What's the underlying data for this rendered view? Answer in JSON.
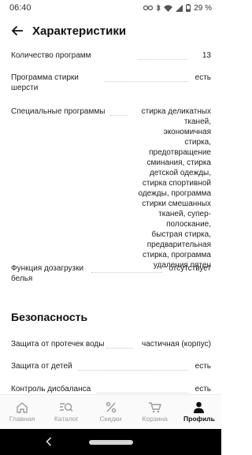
{
  "status": {
    "time": "06:40",
    "battery": "29 %"
  },
  "header": {
    "title": "Характеристики"
  },
  "specs": {
    "program_count": {
      "label": "Количество программ",
      "value": "13"
    },
    "wool_program": {
      "label": "Программа стирки шерсти",
      "value": "есть"
    },
    "special_programs": {
      "label": "Специальные программы",
      "value": "стирка деликатных тканей, экономичная стирка, предотвращение сминания, стирка детской одежды, стирка спортивной одежды, программа стирки смешанных тканей, супер-полоскание, быстрая стирка, предварительная стирка, программа удаления пятен"
    },
    "linen_addition": {
      "label": "Функция дозагрузки белья",
      "value": "отсутствует"
    }
  },
  "safety": {
    "title": "Безопасность",
    "leak_protection": {
      "label": "Защита от протечек воды",
      "value": "частичная (корпус)"
    },
    "child_protection": {
      "label": "Защита от детей",
      "value": "есть"
    },
    "imbalance_control": {
      "label": "Контроль дисбаланса",
      "value": "есть"
    }
  },
  "tabs": [
    {
      "label": "Главная",
      "icon": "home-icon",
      "active": false
    },
    {
      "label": "Каталог",
      "icon": "catalog-search-icon",
      "active": false
    },
    {
      "label": "Скидки",
      "icon": "percent-icon",
      "active": false
    },
    {
      "label": "Корзина",
      "icon": "cart-icon",
      "active": false
    },
    {
      "label": "Профиль",
      "icon": "profile-icon",
      "active": true
    }
  ],
  "colors": {
    "active_tab": "#111111",
    "inactive_tab": "#9a9a9a",
    "nav_bar": "#000000"
  }
}
